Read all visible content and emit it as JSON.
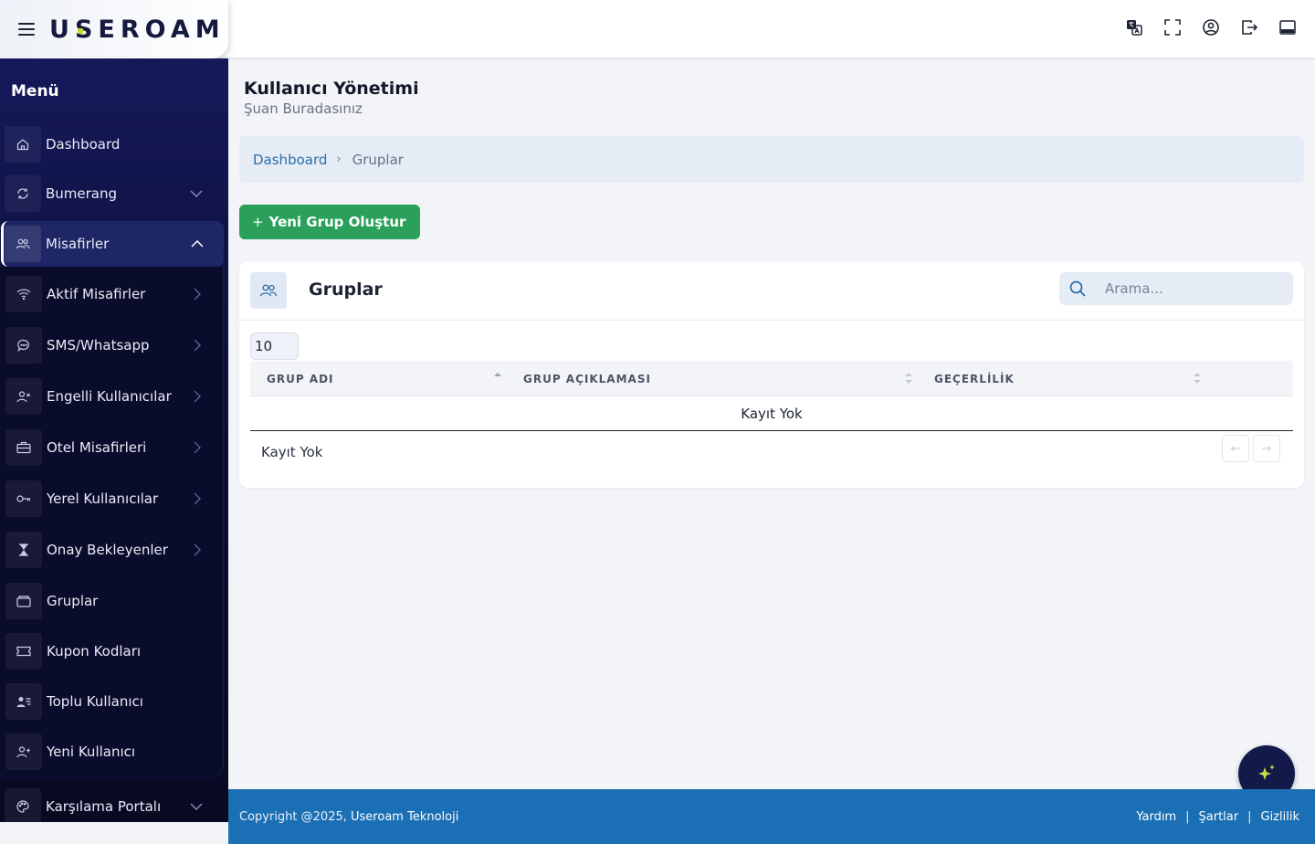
{
  "brand": {
    "logo_text": "USEROAM"
  },
  "sidebar": {
    "title": "Menü",
    "items": [
      {
        "label": "Dashboard",
        "icon": "home-icon"
      },
      {
        "label": "Bumerang",
        "icon": "refresh-icon"
      },
      {
        "label": "Misafirler",
        "icon": "users-icon",
        "expanded": true
      },
      {
        "label": "Karşılama Portalı",
        "icon": "palette-icon"
      }
    ],
    "subitems": [
      {
        "label": "Aktif Misafirler",
        "icon": "wifi-icon"
      },
      {
        "label": "SMS/Whatsapp",
        "icon": "chat-icon"
      },
      {
        "label": "Engelli Kullanıcılar",
        "icon": "user-x-icon"
      },
      {
        "label": "Otel Misafirleri",
        "icon": "briefcase-icon"
      },
      {
        "label": "Yerel Kullanıcılar",
        "icon": "key-icon"
      },
      {
        "label": "Onay Bekleyenler",
        "icon": "hourglass-icon"
      },
      {
        "label": "Gruplar",
        "icon": "folder-icon"
      },
      {
        "label": "Kupon Kodları",
        "icon": "ticket-icon"
      },
      {
        "label": "Toplu Kullanıcı",
        "icon": "user-list-icon"
      },
      {
        "label": "Yeni Kullanıcı",
        "icon": "user-plus-icon"
      }
    ]
  },
  "header": {
    "title": "Kullanıcı Yönetimi",
    "subtitle": "Şuan Buradasınız"
  },
  "breadcrumb": {
    "home": "Dashboard",
    "separator": "›",
    "current": "Gruplar"
  },
  "actions": {
    "create_plus": "+",
    "create_label": "Yeni Grup Oluştur"
  },
  "card": {
    "title": "Gruplar",
    "search_placeholder": "Arama...",
    "page_size": "10",
    "columns": [
      "GRUP ADI",
      "GRUP AÇIKLAMASI",
      "GEÇERLİLİK"
    ],
    "empty_text": "Kayıt Yok",
    "info_text": "Kayıt Yok",
    "prev": "←",
    "next": "→"
  },
  "footer": {
    "copyright": "Copyright @2025,",
    "company": "Useroam Teknoloji",
    "links": [
      "Yardım",
      "Şartlar",
      "Gizlilik"
    ],
    "separator": "|"
  },
  "colors": {
    "sidebar_bg": "#0d0f36",
    "accent_green": "#2aa05a",
    "footer_blue": "#1b6fb4",
    "link_blue": "#2a6ea8"
  }
}
